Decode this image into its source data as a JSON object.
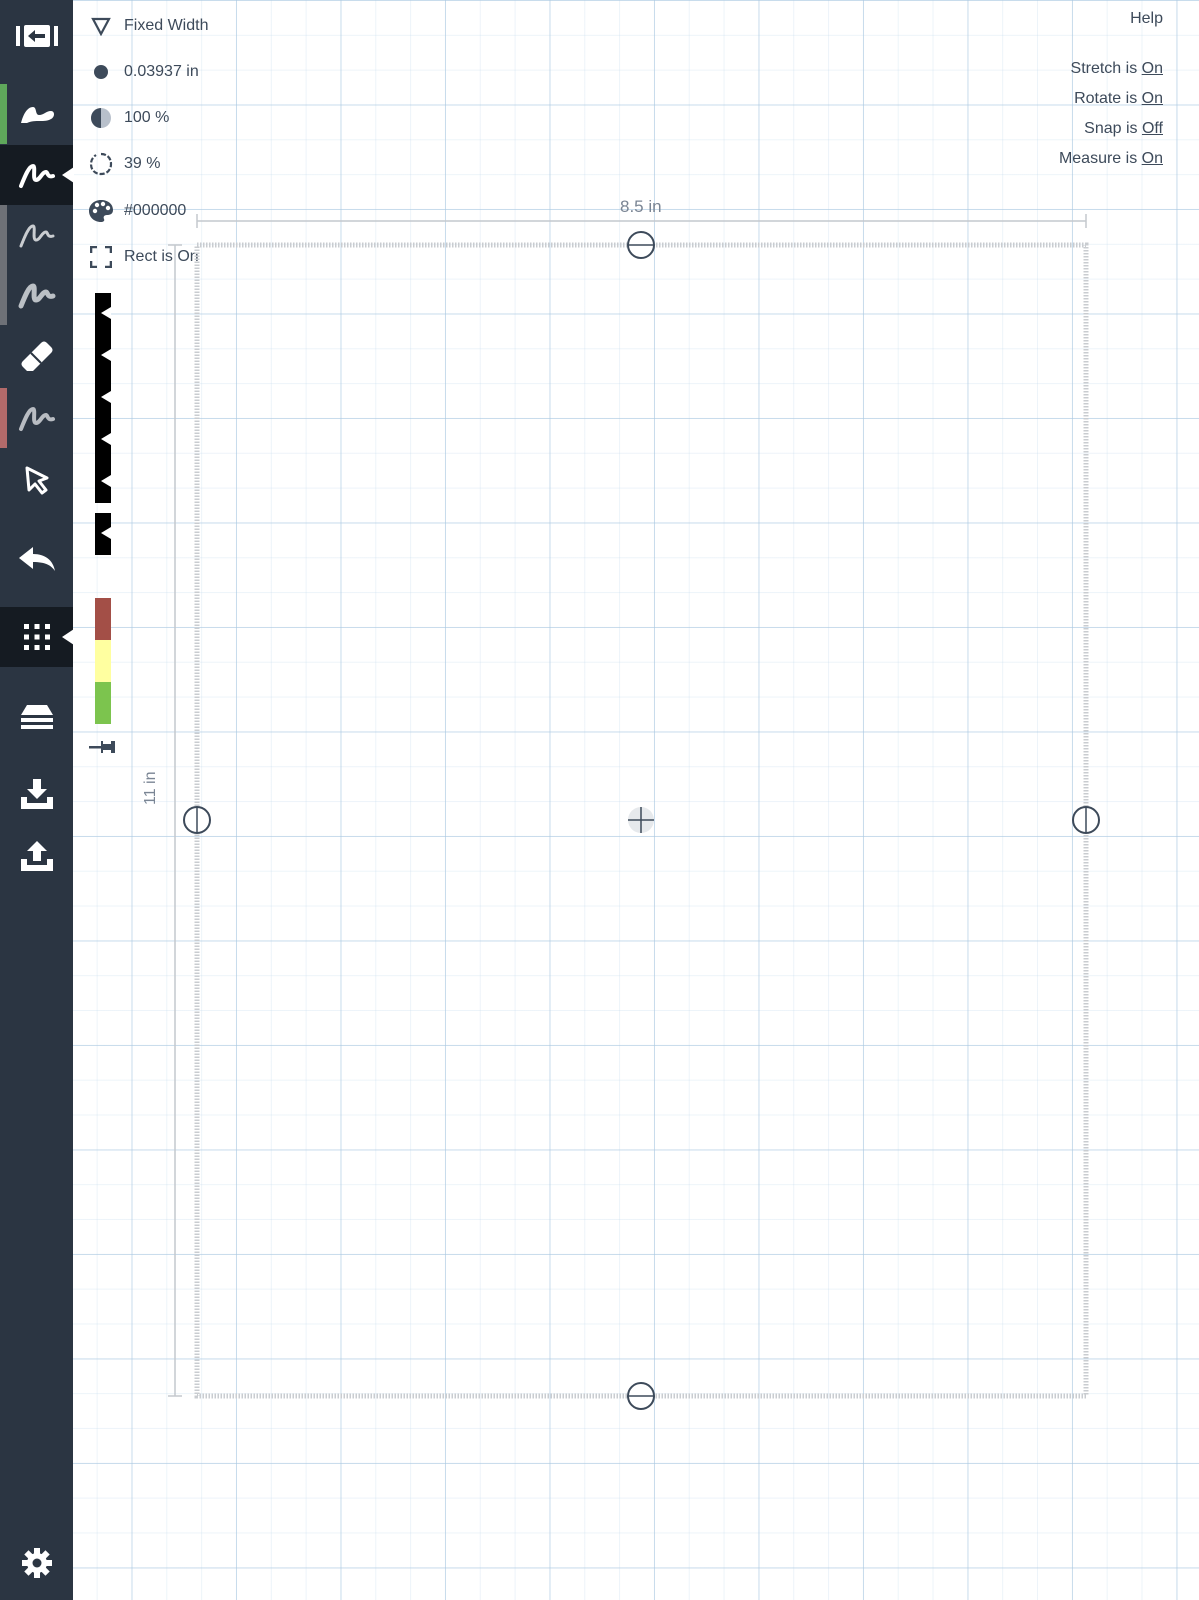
{
  "sidebar": {
    "items": [
      {
        "name": "exit-icon",
        "interactable": true
      },
      {
        "name": "brush-stroke-icon",
        "strip_color": "#5fa85b"
      },
      {
        "name": "pen-tool-icon",
        "active": true
      },
      {
        "name": "pencil-tool-icon"
      },
      {
        "name": "marker-tool-icon"
      },
      {
        "name": "eraser-icon"
      },
      {
        "name": "highlighter-tool-icon",
        "strip_color": "#b26a6a"
      },
      {
        "name": "select-arrow-icon"
      },
      {
        "name": "undo-icon"
      },
      {
        "name": "grid-dots-icon",
        "active": true
      },
      {
        "name": "layers-icon"
      },
      {
        "name": "download-icon"
      },
      {
        "name": "upload-icon"
      },
      {
        "name": "settings-gear-icon"
      }
    ]
  },
  "panel": {
    "mode": {
      "label": "Fixed Width",
      "icon": "triangle-outline-icon"
    },
    "width": {
      "label": "0.03937 in",
      "icon": "filled-circle-icon"
    },
    "opacity": {
      "label": "100 %",
      "icon": "half-circle-icon"
    },
    "smoothing": {
      "label": "39 %",
      "icon": "dashed-circle-icon"
    },
    "color": {
      "label": "#000000",
      "icon": "palette-icon"
    },
    "rect": {
      "label": "Rect is On",
      "icon": "dashed-square-icon"
    }
  },
  "swatches": [
    "#a34f47",
    "#ffffa0",
    "#7cc44e"
  ],
  "toggles": {
    "help": "Help",
    "stretch": {
      "prefix": "Stretch is ",
      "value": "On"
    },
    "rotate": {
      "prefix": "Rotate is ",
      "value": "On"
    },
    "snap": {
      "prefix": "Snap is ",
      "value": "Off"
    },
    "measure": {
      "prefix": "Measure is ",
      "value": "On"
    }
  },
  "page": {
    "width_label": "8.5 in",
    "height_label": "11 in"
  },
  "colors": {
    "sidebar_bg": "#2b3542",
    "sidebar_active": "#151b22",
    "text": "#3d4a5a",
    "grid": "#aac8e1"
  }
}
